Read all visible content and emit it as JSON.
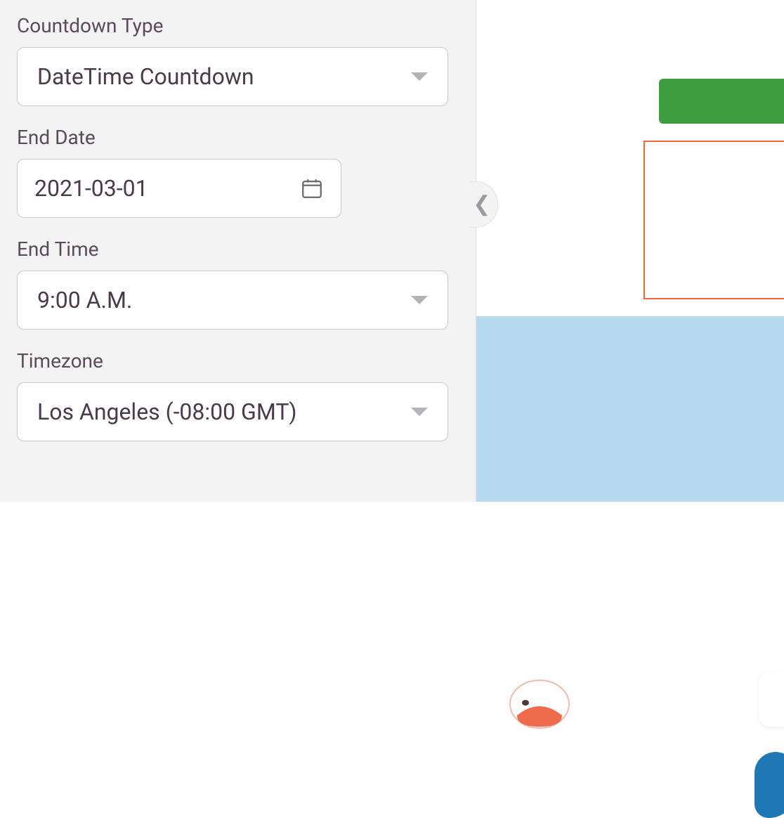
{
  "fields": {
    "countdown_type": {
      "label": "Countdown Type",
      "value": "DateTime Countdown"
    },
    "end_date": {
      "label": "End Date",
      "value": "2021-03-01"
    },
    "end_time": {
      "label": "End Time",
      "value": "9:00 A.M."
    },
    "timezone": {
      "label": "Timezone",
      "value": "Los Angeles (-08:00 GMT)"
    }
  }
}
